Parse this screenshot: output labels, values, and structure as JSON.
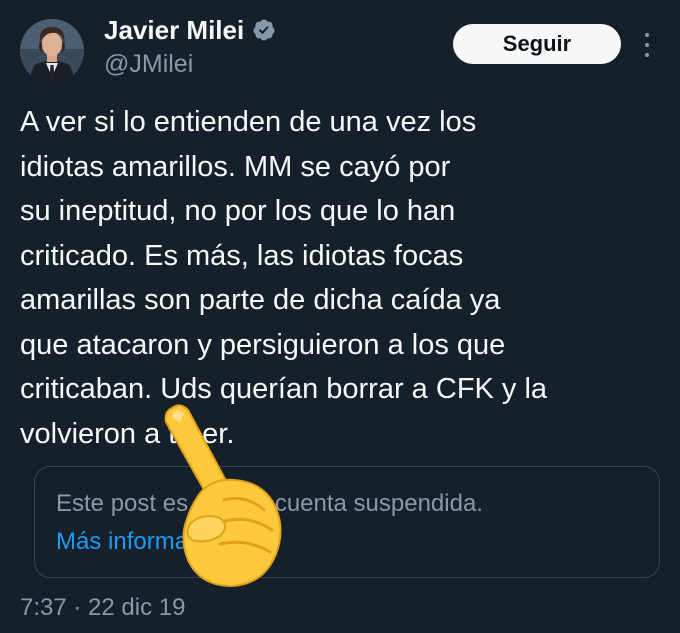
{
  "author": {
    "display_name": "Javier Milei",
    "handle": "@JMilei",
    "verified_icon": "verified-badge-icon",
    "avatar_icon": "profile-photo"
  },
  "actions": {
    "follow_label": "Seguir",
    "more_icon": "more-options-icon"
  },
  "tweet": {
    "text": "A ver si lo entienden de una vez los\nidiotas amarillos. MM se cayó por\nsu ineptitud, no por los que lo han\ncriticado. Es más, las idiotas focas\namarillas son parte de dicha caída ya\nque atacaron y persiguieron a los que\ncriticaban. Uds querían borrar a CFK y la\nvolvieron a traer."
  },
  "quote": {
    "message": "Este post es de una cuenta suspendida.",
    "link": "Más información"
  },
  "meta": {
    "timestamp": "7:37 · 22 dic 19"
  },
  "overlay": {
    "emoji": "backhand-index-pointing-up-emoji"
  },
  "colors": {
    "background": "#15202b",
    "text": "#f7f9f9",
    "secondary_text": "#8b98a5",
    "link": "#1d9bf0",
    "verified": "#829aab",
    "border": "#38444d",
    "emoji": "#ffc83d"
  }
}
